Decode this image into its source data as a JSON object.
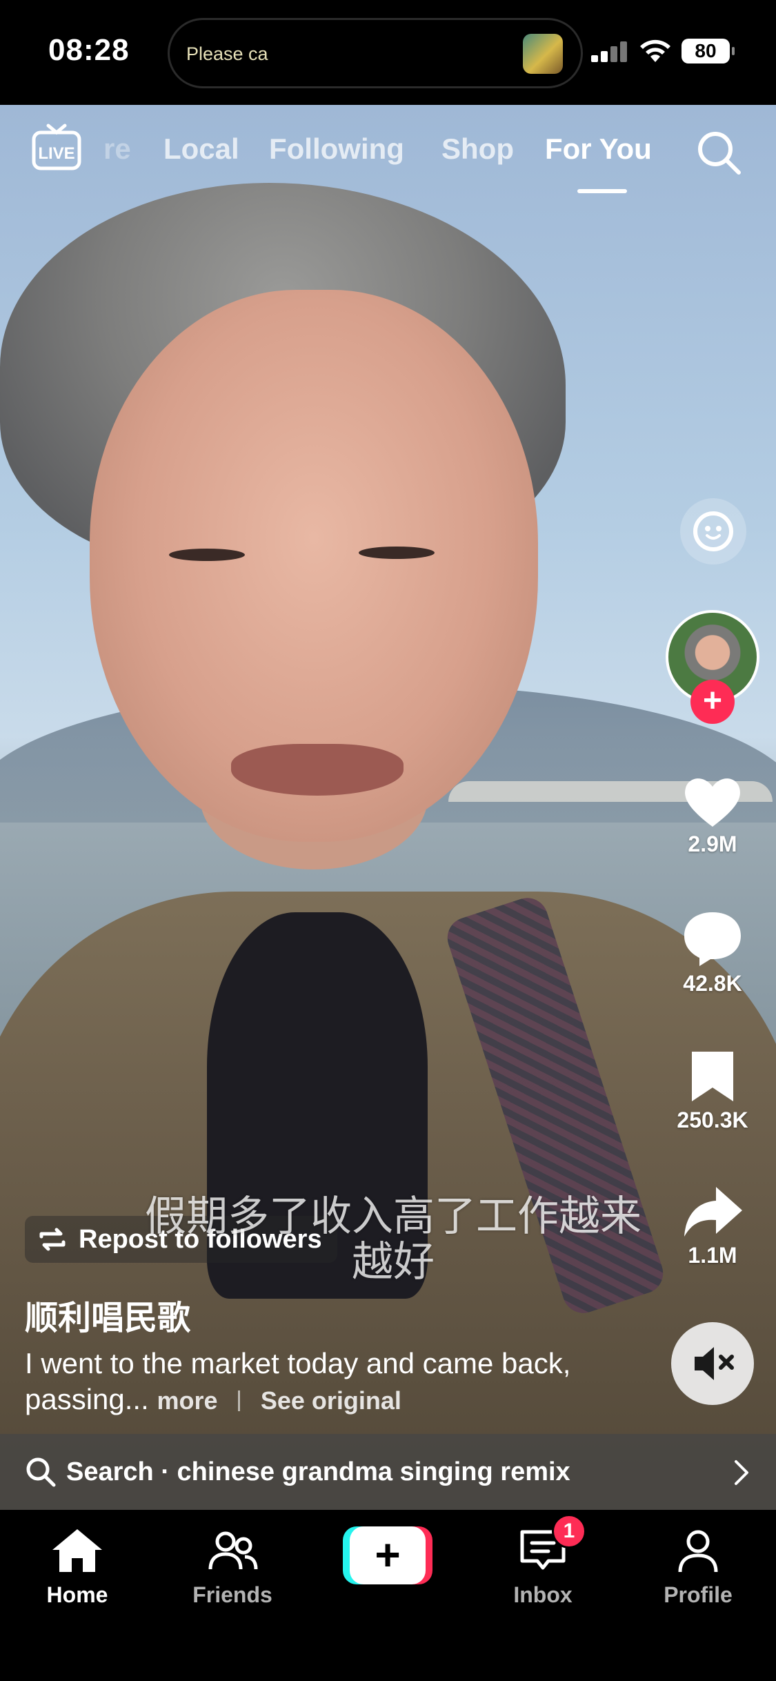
{
  "status_bar": {
    "time": "08:28",
    "island_text": "Please ca",
    "battery": "80"
  },
  "top_nav": {
    "live_label": "LIVE",
    "tabs": [
      {
        "label": "re"
      },
      {
        "label": "Local"
      },
      {
        "label": "Following"
      },
      {
        "label": "Shop"
      },
      {
        "label": "For You",
        "active": true
      }
    ]
  },
  "right_rail": {
    "like_count": "2.9M",
    "comment_count": "42.8K",
    "bookmark_count": "250.3K",
    "share_count": "1.1M"
  },
  "video": {
    "subtitle": "假期多了收入高了工作越来越好"
  },
  "caption": {
    "repost_label": "Repost to followers",
    "author": "顺利唱民歌",
    "description": "I went to the market today and came back, passing...",
    "more_label": "more",
    "see_original_label": "See original"
  },
  "search_bar": {
    "text": "Search · chinese grandma singing remix"
  },
  "bottom_nav": {
    "items": [
      {
        "label": "Home",
        "icon": "home-icon",
        "active": true
      },
      {
        "label": "Friends",
        "icon": "friends-icon"
      },
      {
        "label": "",
        "icon": "create-plus-icon"
      },
      {
        "label": "Inbox",
        "icon": "inbox-icon",
        "badge": "1"
      },
      {
        "label": "Profile",
        "icon": "profile-icon"
      }
    ]
  },
  "colors": {
    "accent": "#fe2c55",
    "cyan": "#25f4ee"
  }
}
